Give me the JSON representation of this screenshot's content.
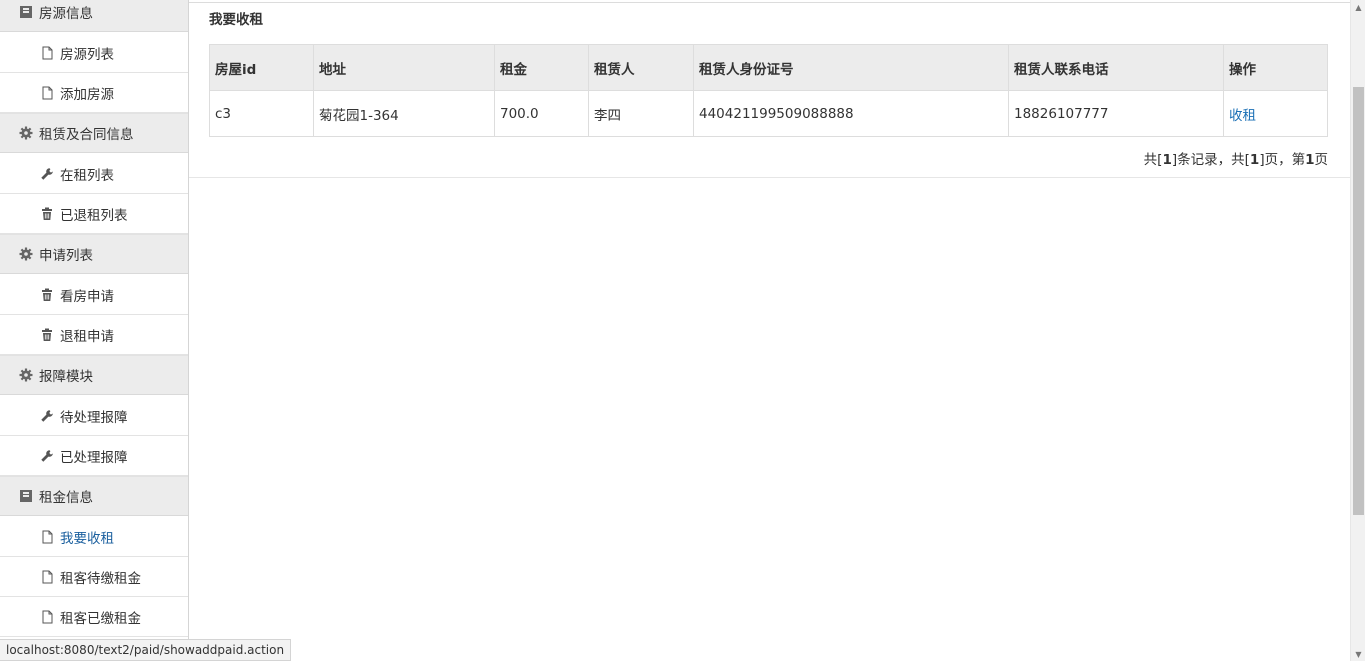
{
  "sidebar": {
    "groups": [
      {
        "label": "房源信息",
        "icon": "book-icon"
      },
      {
        "label": "租赁及合同信息",
        "icon": "cog-icon"
      },
      {
        "label": "申请列表",
        "icon": "cog-icon"
      },
      {
        "label": "报障模块",
        "icon": "cog-icon"
      },
      {
        "label": "租金信息",
        "icon": "book-icon"
      }
    ],
    "items": [
      {
        "label": "房源列表",
        "icon": "file-icon"
      },
      {
        "label": "添加房源",
        "icon": "file-icon"
      },
      {
        "label": "在租列表",
        "icon": "wrench-icon"
      },
      {
        "label": "已退租列表",
        "icon": "trash-icon"
      },
      {
        "label": "看房申请",
        "icon": "trash-icon"
      },
      {
        "label": "退租申请",
        "icon": "trash-icon"
      },
      {
        "label": "待处理报障",
        "icon": "wrench-icon"
      },
      {
        "label": "已处理报障",
        "icon": "wrench-icon"
      },
      {
        "label": "我要收租",
        "icon": "file-icon"
      },
      {
        "label": "租客待缴租金",
        "icon": "file-icon"
      },
      {
        "label": "租客已缴租金",
        "icon": "file-icon"
      }
    ]
  },
  "main": {
    "title": "我要收租",
    "table": {
      "headers": [
        "房屋id",
        "地址",
        "租金",
        "租赁人",
        "租赁人身份证号",
        "租赁人联系电话",
        "操作"
      ],
      "rows": [
        [
          "c3",
          "菊花园1-364",
          "700.0",
          "李四",
          "440421199509088888",
          "18826107777",
          "收租"
        ]
      ]
    },
    "pager": {
      "pre": "共[",
      "records": "1",
      "mid1": "]条记录，共[",
      "pages": "1",
      "mid2": "]页，第",
      "current": "1",
      "post": "页"
    }
  },
  "statusbar": {
    "url": "localhost:8080/text2/paid/showaddpaid.action"
  },
  "colors": {
    "accent": "#1a6fb5",
    "header_bg": "#ececec"
  }
}
